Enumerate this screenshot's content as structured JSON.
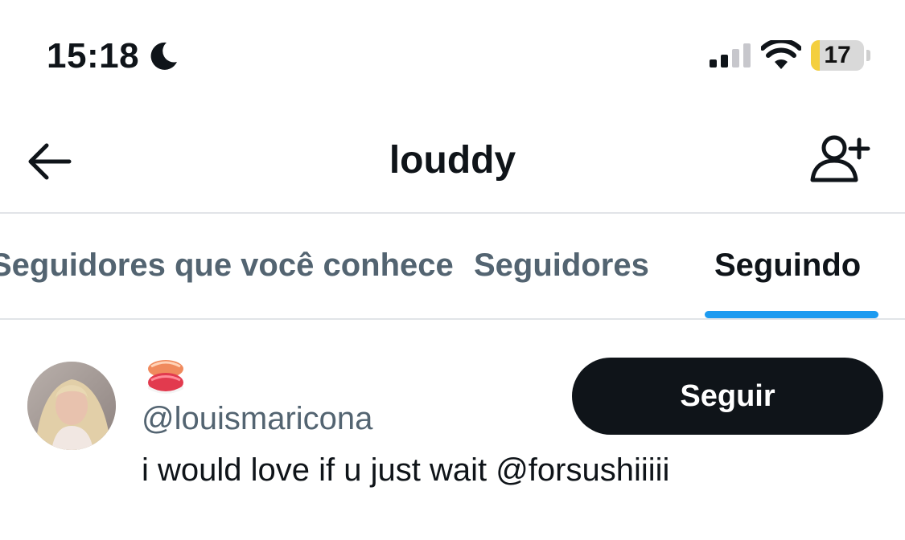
{
  "status_bar": {
    "time": "15:18",
    "battery_level": "17",
    "battery_fraction": 0.17,
    "icons": [
      "moon-icon",
      "signal-icon",
      "wifi-icon",
      "battery-icon"
    ]
  },
  "header": {
    "title": "louddy",
    "icons": [
      "back-arrow-icon",
      "add-user-icon"
    ]
  },
  "tabs": [
    {
      "label": "Seguidores que você conhece",
      "active": false
    },
    {
      "label": "Seguidores",
      "active": false
    },
    {
      "label": "Seguindo",
      "active": true
    }
  ],
  "list": {
    "items": [
      {
        "display_name_icon": "sushi-emoji-icon",
        "username": "@louismaricona",
        "bio": "i would love if u just wait @forsushiiiii",
        "follow_label": "Seguir"
      }
    ]
  },
  "colors": {
    "accent": "#1d9bf0",
    "text_primary": "#0f1419",
    "text_secondary": "#536471",
    "battery_low": "#f4cf3e"
  }
}
